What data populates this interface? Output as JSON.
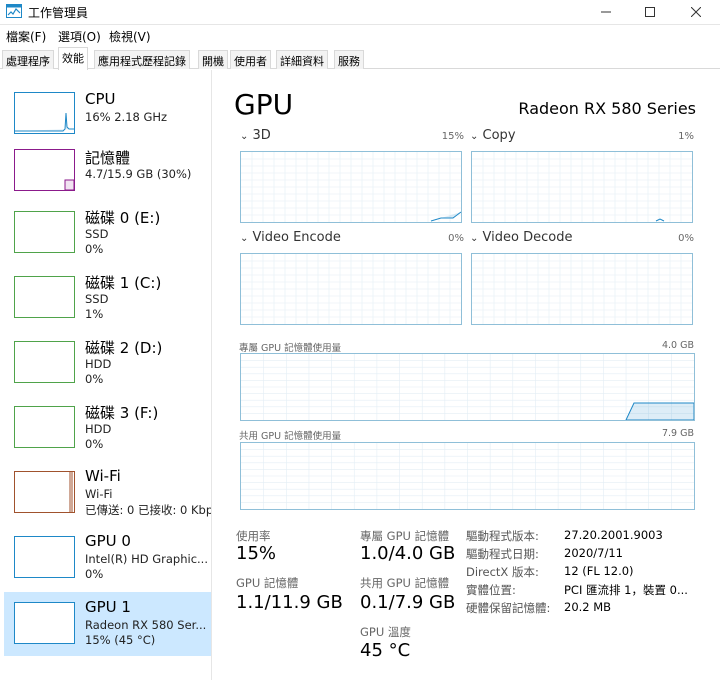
{
  "window": {
    "title": "工作管理員"
  },
  "menu": {
    "file": "檔案(F)",
    "options": "選項(O)",
    "view": "檢視(V)"
  },
  "tabs": [
    "處理程序",
    "效能",
    "應用程式歷程記錄",
    "開機",
    "使用者",
    "詳細資料",
    "服務"
  ],
  "sidebar": {
    "items": [
      {
        "name": "CPU",
        "sub1": "16% 2.18 GHz",
        "sub2": "",
        "color": "#1e88c7"
      },
      {
        "name": "記憶體",
        "sub1": "4.7/15.9 GB (30%)",
        "sub2": "",
        "color": "#8b1a8b"
      },
      {
        "name": "磁碟 0 (E:)",
        "sub1": "SSD",
        "sub2": "0%",
        "color": "#4fa34a"
      },
      {
        "name": "磁碟 1 (C:)",
        "sub1": "SSD",
        "sub2": "1%",
        "color": "#4fa34a"
      },
      {
        "name": "磁碟 2 (D:)",
        "sub1": "HDD",
        "sub2": "0%",
        "color": "#4fa34a"
      },
      {
        "name": "磁碟 3 (F:)",
        "sub1": "HDD",
        "sub2": "0%",
        "color": "#4fa34a"
      },
      {
        "name": "Wi-Fi",
        "sub1": "Wi-Fi",
        "sub2": "已傳送: 0 已接收: 0 Kbp",
        "color": "#a0522d"
      },
      {
        "name": "GPU 0",
        "sub1": "Intel(R) HD Graphic...",
        "sub2": "0%",
        "color": "#1e88c7"
      },
      {
        "name": "GPU 1",
        "sub1": "Radeon RX 580 Ser...",
        "sub2": "15% (45 °C)",
        "color": "#1e88c7"
      }
    ]
  },
  "main": {
    "title": "GPU",
    "model": "Radeon RX 580 Series",
    "engines": [
      {
        "label": "3D",
        "pct": "15%"
      },
      {
        "label": "Copy",
        "pct": "1%"
      },
      {
        "label": "Video Encode",
        "pct": "0%"
      },
      {
        "label": "Video Decode",
        "pct": "0%"
      }
    ],
    "dedicated_label": "專屬 GPU 記憶體使用量",
    "dedicated_max": "4.0 GB",
    "shared_label": "共用 GPU 記憶體使用量",
    "shared_max": "7.9 GB",
    "stats": {
      "util_label": "使用率",
      "util_value": "15%",
      "dedicated_label": "專屬 GPU 記憶體",
      "dedicated_value": "1.0/4.0 GB",
      "gpumem_label": "GPU 記憶體",
      "gpumem_value": "1.1/11.9 GB",
      "shared_label": "共用 GPU 記憶體",
      "shared_value": "0.1/7.9 GB",
      "temp_label": "GPU 溫度",
      "temp_value": "45 °C"
    },
    "info": [
      {
        "label": "驅動程式版本:",
        "value": "27.20.2001.9003"
      },
      {
        "label": "驅動程式日期:",
        "value": "2020/7/11"
      },
      {
        "label": "DirectX 版本:",
        "value": "12 (FL 12.0)"
      },
      {
        "label": "實體位置:",
        "value": "PCI 匯流排 1，裝置 0..."
      },
      {
        "label": "硬體保留記憶體:",
        "value": "20.2 MB"
      }
    ]
  }
}
